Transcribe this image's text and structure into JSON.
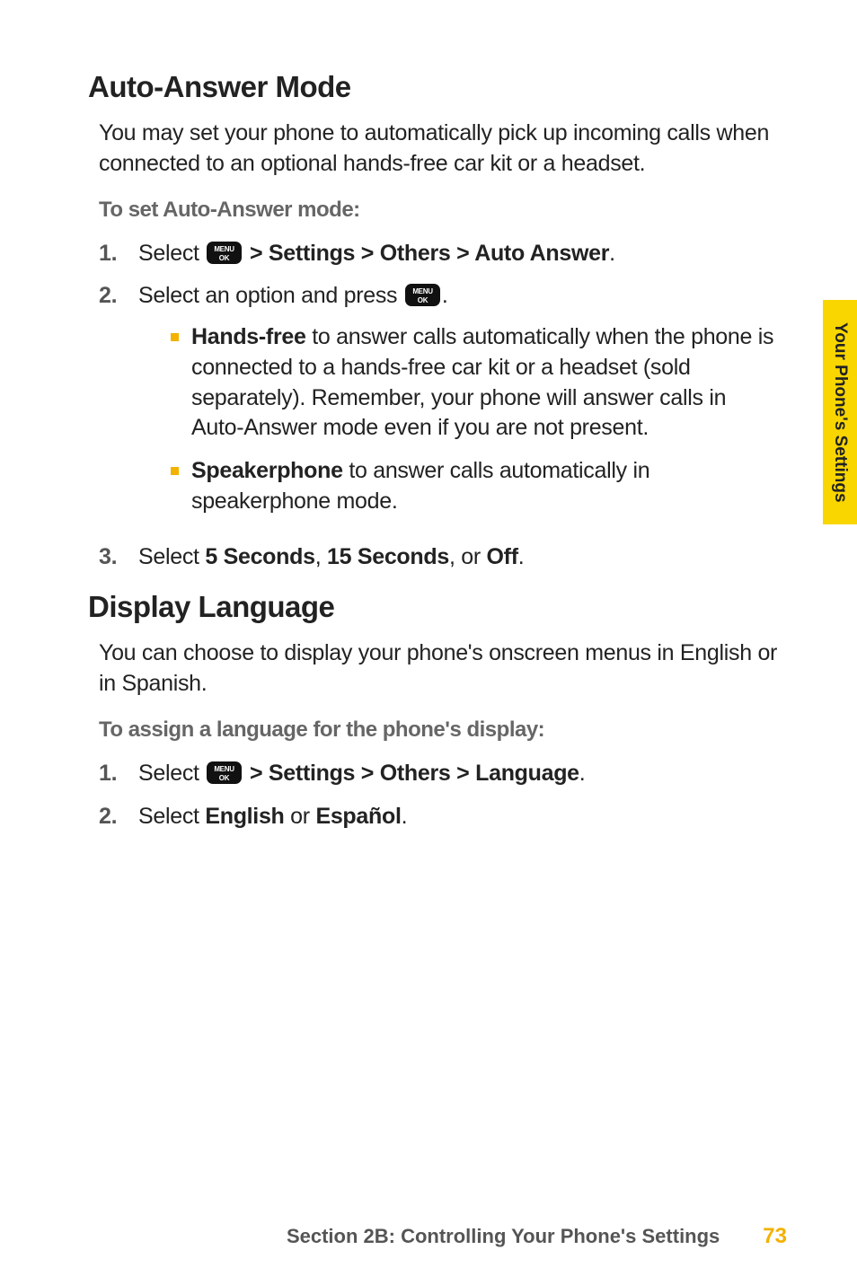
{
  "sideTab": "Your Phone's Settings",
  "sections": {
    "autoAnswer": {
      "heading": "Auto-Answer Mode",
      "intro": "You may set your phone to automatically pick up incoming calls when connected to an optional hands-free car kit or a headset.",
      "sub": "To set Auto-Answer mode:",
      "steps": {
        "s1": {
          "num": "1.",
          "pre": "Select ",
          "post": " > Settings > Others > Auto Answer"
        },
        "s2": {
          "num": "2.",
          "pre": "Select an option and press "
        },
        "bullets": {
          "b1": {
            "bold": "Hands-free",
            "rest": " to answer calls automatically when the phone is connected to a hands-free car kit or a headset (sold separately). Remember, your phone will answer calls in Auto-Answer mode even if you are not present."
          },
          "b2": {
            "bold": "Speakerphone",
            "rest": " to answer calls automatically in speakerphone mode."
          }
        },
        "s3": {
          "num": "3.",
          "pre": "Select ",
          "b1": "5 Seconds",
          "mid1": ", ",
          "b2": "15 Seconds",
          "mid2": ", or ",
          "b3": "Off",
          "end": "."
        }
      }
    },
    "displayLang": {
      "heading": "Display Language",
      "intro": "You can choose to display your phone's onscreen menus in English or in Spanish.",
      "sub": "To assign a language for the phone's display:",
      "steps": {
        "s1": {
          "num": "1.",
          "pre": "Select ",
          "post": " > Settings > Others > Language"
        },
        "s2": {
          "num": "2.",
          "pre": "Select ",
          "b1": "English",
          "mid": " or ",
          "b2": "Español",
          "end": "."
        }
      }
    }
  },
  "menuKey": {
    "line1": "MENU",
    "line2": "OK"
  },
  "footer": {
    "section": "Section 2B: Controlling Your Phone's Settings",
    "page": "73"
  }
}
